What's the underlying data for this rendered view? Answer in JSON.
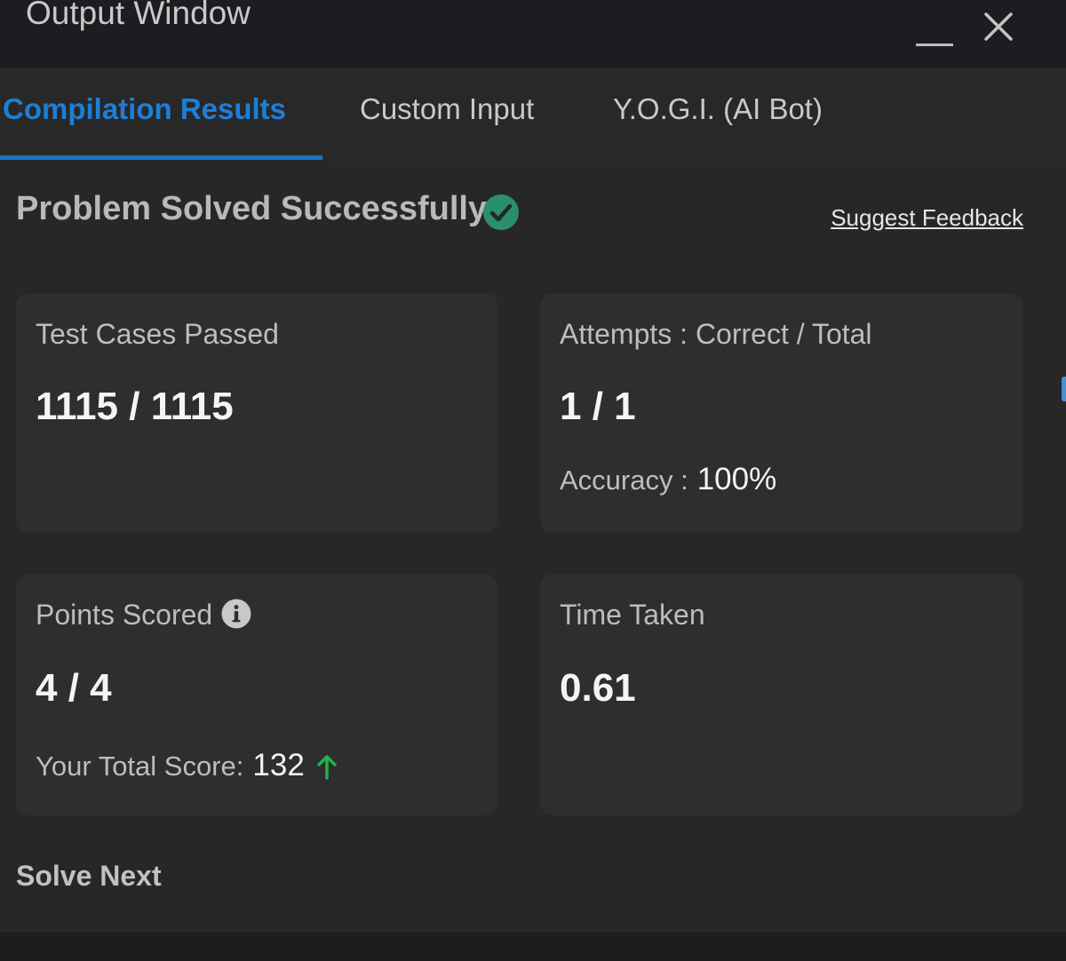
{
  "window": {
    "title": "Output Window"
  },
  "tabs": [
    {
      "label": "Compilation Results",
      "active": true
    },
    {
      "label": "Custom Input",
      "active": false
    },
    {
      "label": "Y.O.G.I. (AI Bot)",
      "active": false
    }
  ],
  "status": {
    "title": "Problem Solved Successfully",
    "icon": "check-circle-icon",
    "feedback_link": "Suggest Feedback"
  },
  "cards": {
    "test_cases": {
      "label": "Test Cases Passed",
      "value": "1115 / 1115"
    },
    "attempts": {
      "label": "Attempts : Correct / Total",
      "value": "1 / 1",
      "sub_label": "Accuracy :",
      "sub_value": "100%"
    },
    "points": {
      "label": "Points Scored",
      "icon": "info-icon",
      "value": "4 / 4",
      "sub_label": "Your Total Score:",
      "sub_value": "132",
      "sub_icon": "up-arrow-icon"
    },
    "time": {
      "label": "Time Taken",
      "value": "0.61"
    }
  },
  "footer": {
    "solve_next": "Solve Next"
  },
  "colors": {
    "accent": "#1e7ed6",
    "success": "#2a8f6c",
    "trend_up": "#22b14c",
    "background": "#272727",
    "card": "#2e2e2e",
    "titlebar": "#1c1d20"
  }
}
